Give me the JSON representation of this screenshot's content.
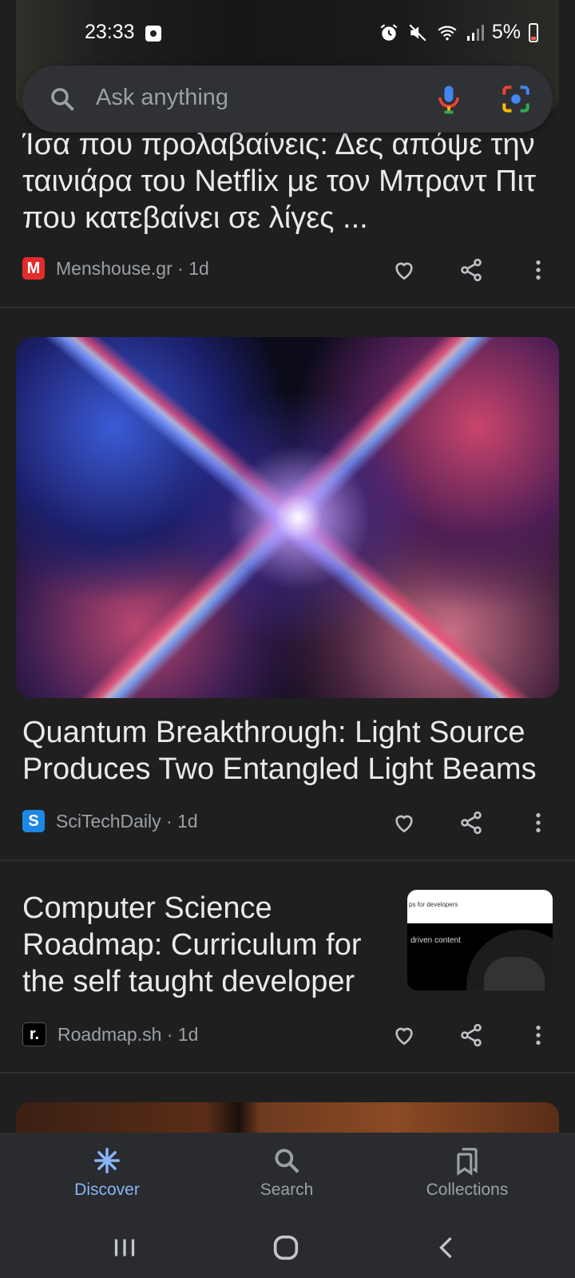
{
  "status_bar": {
    "time": "23:33",
    "battery": "5%",
    "icons": [
      "alarm-icon",
      "mute-icon",
      "wifi-icon",
      "signal-icon",
      "battery-icon"
    ]
  },
  "search": {
    "placeholder": "Ask anything",
    "icons": [
      "search-icon",
      "mic-icon",
      "lens-icon"
    ]
  },
  "articles": [
    {
      "headline": "Ίσα που προλαβαίνεις: Δες απόψε την ταινιάρα του Netflix με τον Μπραντ Πιτ που κατεβαίνει σε λίγες ...",
      "source": "Menshouse.gr",
      "age": "1d",
      "logo_color": "#e32b2b"
    },
    {
      "headline": "Quantum Breakthrough: Light Source Produces Two Entangled Light Beams",
      "source": "SciTechDaily",
      "age": "1d",
      "logo_color": "#1e88e5"
    },
    {
      "headline": "Computer Science Roadmap: Curriculum for the self taught developer",
      "source": "Roadmap.sh",
      "age": "1d",
      "logo_color": "#000000",
      "thumb_text_1": "ps for developers",
      "thumb_text_2": "driven content"
    }
  ],
  "bottom_nav": {
    "items": [
      {
        "label": "Discover",
        "icon": "discover-icon",
        "active": true
      },
      {
        "label": "Search",
        "icon": "search-icon",
        "active": false
      },
      {
        "label": "Collections",
        "icon": "collections-icon",
        "active": false
      }
    ]
  },
  "colors": {
    "background": "#1f1f1f",
    "accent": "#8ab4f8"
  }
}
